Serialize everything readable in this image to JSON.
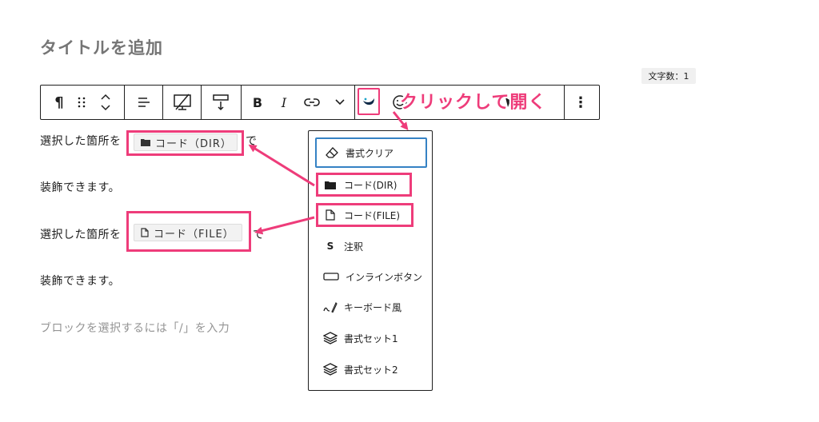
{
  "editor": {
    "title_placeholder": "タイトルを追加",
    "word_count": "文字数：1",
    "paragraphs": {
      "p1_prefix": "選択した箇所を",
      "p1_suffix": "で",
      "p2": "装飾できます。",
      "p3_prefix": "選択した箇所を",
      "p3_suffix": "で",
      "p4": "装飾できます。"
    },
    "code_dir_label": "コード（DIR）",
    "code_file_label": "コード（FILE）",
    "block_placeholder": "ブロックを選択するには「/」を入力"
  },
  "toolbar": {
    "paragraph_glyph": "¶",
    "bold_glyph": "B",
    "italic_glyph": "I",
    "more_glyph": "⋮"
  },
  "annotation": {
    "callout": "クリックして開く",
    "accent_color": "#ee3c7a"
  },
  "dropdown": {
    "items": [
      {
        "label": "書式クリア",
        "icon": "eraser-icon"
      },
      {
        "label": "コード(DIR)",
        "icon": "folder-icon"
      },
      {
        "label": "コード(FILE)",
        "icon": "file-icon"
      },
      {
        "label": "注釈",
        "icon": "s-letter-icon",
        "glyph": "S"
      },
      {
        "label": "インラインボタン",
        "icon": "button-shape-icon"
      },
      {
        "label": "キーボード風",
        "icon": "keyboard-pen-icon"
      },
      {
        "label": "書式セット1",
        "icon": "layers-icon"
      },
      {
        "label": "書式セット2",
        "icon": "layers-icon"
      }
    ]
  }
}
